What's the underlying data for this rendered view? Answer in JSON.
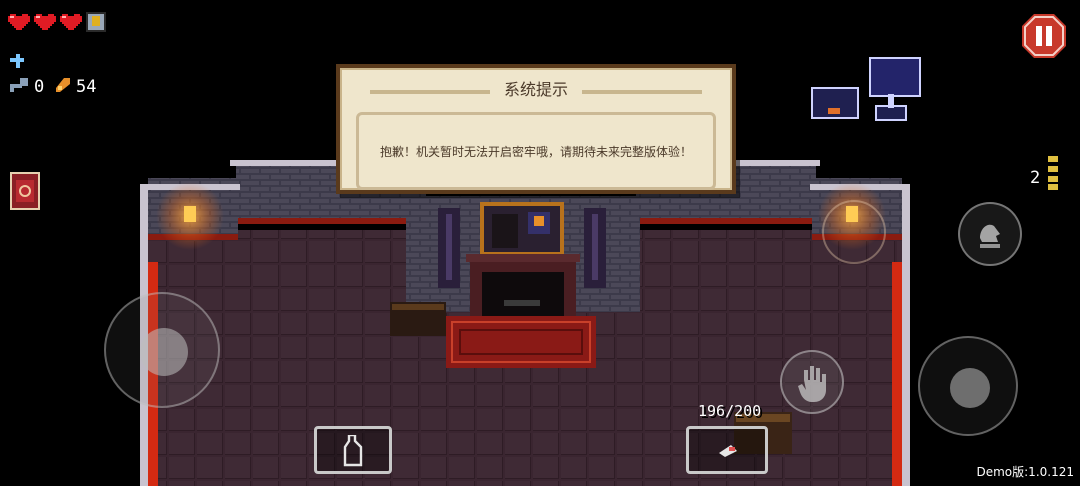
{
  "hud": {
    "hearts_full": 3,
    "keys_count": "0",
    "shells_count": "54",
    "ammo_text": "196/200",
    "blanks_count": "2"
  },
  "dialog": {
    "title": "系统提示",
    "message": "抱歉！机关暂时无法开启密牢哦，请期待未来完整版体验！"
  },
  "version": "Demo版:1.0.121",
  "icons": {
    "pause": "pause-icon",
    "heart": "heart-icon",
    "armor": "armor-icon",
    "key": "key-icon",
    "shell": "shell-currency-icon",
    "blank": "blank-icon",
    "item": "spellbook-icon",
    "dodge": "dodge-roll-icon",
    "interact": "hand-icon",
    "active_item": "bottle-icon",
    "gun": "gun-icon"
  },
  "colors": {
    "heart_red": "#e01b24",
    "pause_red": "#c8392b",
    "dialog_bg": "#efe6cc",
    "wall_red": "#d42a12"
  }
}
